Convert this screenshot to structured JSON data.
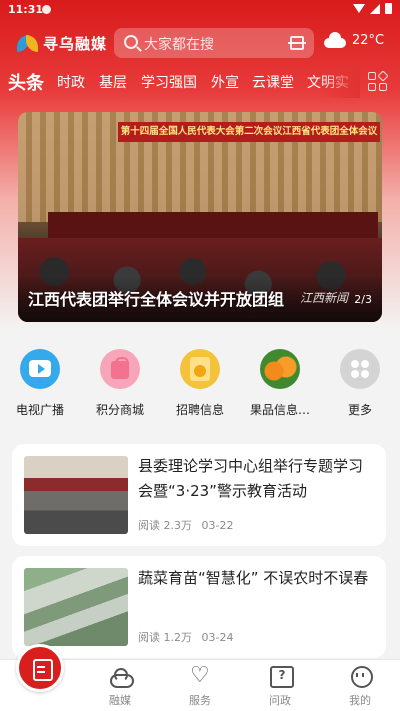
{
  "status_bar": {
    "time": "11:31"
  },
  "header": {
    "app_name": "寻乌融媒",
    "search_placeholder": "大家都在搜",
    "temperature": "22°C"
  },
  "tabs": [
    "头条",
    "时政",
    "基层",
    "学习强国",
    "外宣",
    "云课堂",
    "文明实"
  ],
  "banner": {
    "stage_title": "第十四届全国人民代表大会第二次会议江西省代表团全体会议",
    "caption": "江西代表团举行全体会议并开放团组",
    "watermark": "江西新闻",
    "page": "2/3"
  },
  "quick_nav": [
    {
      "label": "电视广播",
      "icon": "tv-play-icon"
    },
    {
      "label": "积分商城",
      "icon": "shopping-bag-icon"
    },
    {
      "label": "招聘信息",
      "icon": "job-icon"
    },
    {
      "label": "果品信息…",
      "icon": "fruit-icon"
    },
    {
      "label": "更多",
      "icon": "more-icon"
    }
  ],
  "news": [
    {
      "title": "县委理论学习中心组举行专题学习会暨“3·23”警示教育活动",
      "reads": "阅读 2.3万",
      "date": "03-22"
    },
    {
      "title": "蔬菜育苗“智慧化” 不误农时不误春",
      "reads": "阅读 1.2万",
      "date": "03-24"
    }
  ],
  "bottom_nav": [
    "融媒",
    "服务",
    "问政",
    "我的"
  ]
}
